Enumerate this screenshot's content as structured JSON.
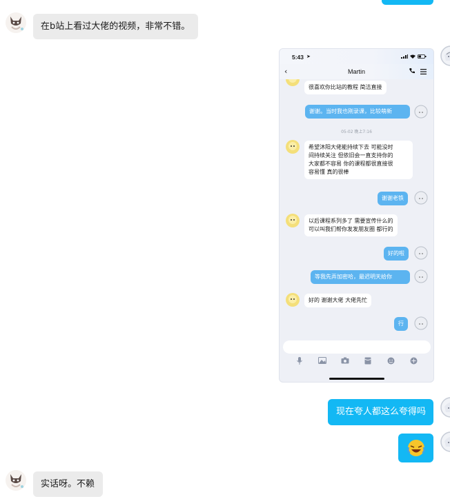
{
  "chat": {
    "messages": [
      {
        "side": "left",
        "text": "在b站上看过大佬的视频，非常不错。"
      },
      {
        "side": "right",
        "type": "screenshot"
      },
      {
        "side": "right",
        "text": "现在夸人都这么夸得吗"
      },
      {
        "side": "right",
        "type": "emoji",
        "icon": "laughing-cry-emoji"
      },
      {
        "side": "left",
        "text": "实话呀。不赖"
      }
    ],
    "msg1": "在b站上看过大佬的视频，非常不错。",
    "msg3": "现在夸人都这么夸得吗",
    "msg5": "实话呀。不赖"
  },
  "screenshot": {
    "status_time": "5:43",
    "title": "Martin",
    "messages": {
      "m1": "很喜欢你比站的教程 简洁直接",
      "m2": "谢谢。当时我也刚录课，比较萌新",
      "stamp": "05-02 晚上7:16",
      "m3_l1": "希望沐阳大佬能持续下去 可能没时",
      "m3_l2": "间持续关注 但依旧会一直支持你的",
      "m3_l3": "大家都不容易 你的课程都很直接很",
      "m3_l4": "容易懂 真的很棒",
      "m4": "谢谢老铁",
      "m5_l1": "以后课程系列多了 需要宣传什么的",
      "m5_l2": "可以叫我们帮你发发朋友圈 都行的",
      "m6": "好的啦",
      "m7": "等我先弄加密哈，最迟明天给你",
      "m8": "好的 谢谢大佬 大佬先忙",
      "m9": "行"
    }
  },
  "colors": {
    "sent_bubble": "#13b8f4",
    "received_bubble": "#ebebeb",
    "phone_sent_bubble": "#5cb4f0"
  }
}
